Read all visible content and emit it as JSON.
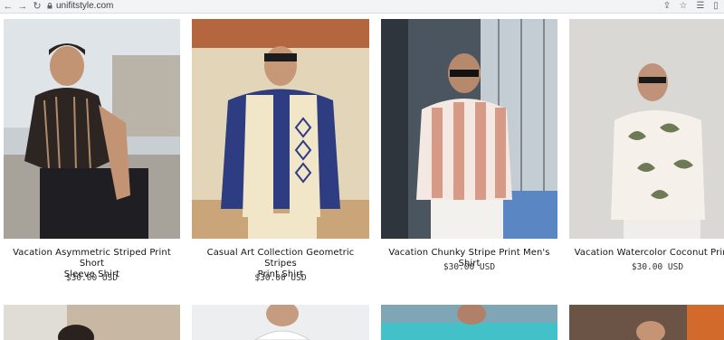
{
  "browser": {
    "url": "unifitstyle.com",
    "icons": [
      "back-arrow-icon",
      "forward-arrow-icon",
      "reload-icon",
      "lock-icon",
      "share-icon",
      "star-icon",
      "reading-list-icon",
      "sidebar-icon"
    ]
  },
  "products": [
    {
      "title_line1": "Vacation Asymmetric Striped Print Short",
      "title_line2": "Sleeve Shirt",
      "price": "$30.00 USD"
    },
    {
      "title_line1": "Casual Art Collection Geometric Stripes",
      "title_line2": "Print Shirt",
      "price": "$30.00 USD"
    },
    {
      "title_line1": "Vacation Chunky Stripe Print Men's Shirt",
      "title_line2": "",
      "price": "$30.00 USD"
    },
    {
      "title_line1": "Vacation Watercolor Coconut Print S",
      "title_line2": "",
      "price": "$30.00 USD"
    }
  ],
  "colors": {
    "page_bg": "#ffffff",
    "chrome_bg": "#f1f3f4",
    "title_text": "#121212",
    "price_text": "#333333"
  }
}
